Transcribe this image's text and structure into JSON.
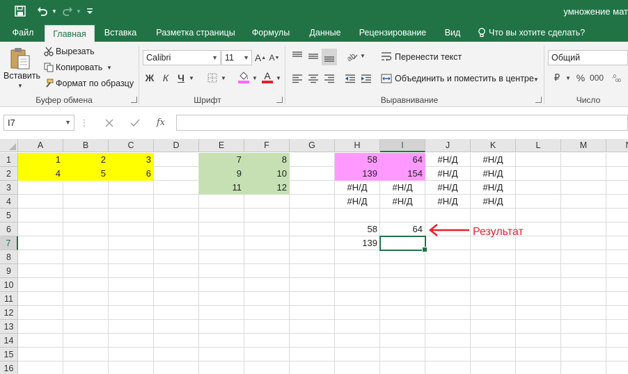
{
  "title_bar": {
    "document_title": "умножение мат",
    "save_icon": "save-icon",
    "undo_icon": "undo-icon",
    "redo_icon": "redo-icon",
    "customize_icon": "customize-qat-icon"
  },
  "tabs": [
    {
      "label": "Файл",
      "active": false
    },
    {
      "label": "Главная",
      "active": true
    },
    {
      "label": "Вставка",
      "active": false
    },
    {
      "label": "Разметка страницы",
      "active": false
    },
    {
      "label": "Формулы",
      "active": false
    },
    {
      "label": "Данные",
      "active": false
    },
    {
      "label": "Рецензирование",
      "active": false
    },
    {
      "label": "Вид",
      "active": false
    }
  ],
  "tell_me": {
    "icon": "lightbulb-icon",
    "label": "Что вы хотите сделать?"
  },
  "ribbon": {
    "clipboard": {
      "paste_label": "Вставить",
      "cut_label": "Вырезать",
      "copy_label": "Копировать",
      "format_painter_label": "Формат по образцу",
      "group_label": "Буфер обмена"
    },
    "font": {
      "font_name": "Calibri",
      "font_size": "11",
      "bold_label": "Ж",
      "italic_label": "К",
      "underline_label": "Ч",
      "group_label": "Шрифт",
      "highlight_color": "#ff66ff",
      "font_color": "#e5202e"
    },
    "alignment": {
      "wrap_text_label": "Перенести текст",
      "merge_center_label": "Объединить и поместить в центре",
      "group_label": "Выравнивание"
    },
    "number": {
      "format": "Общий",
      "currency_symbol": "₽",
      "percent_symbol": "%",
      "thousands_label": "000",
      "group_label": "Число"
    }
  },
  "formula_bar": {
    "name_box": "I7",
    "cancel_icon": "cancel-icon",
    "enter_icon": "check-icon",
    "function_label": "fx",
    "formula": ""
  },
  "sheet": {
    "columns": [
      "A",
      "B",
      "C",
      "D",
      "E",
      "F",
      "G",
      "H",
      "I",
      "J",
      "K",
      "L",
      "M",
      "N"
    ],
    "rows": [
      "1",
      "2",
      "3",
      "4",
      "5",
      "6",
      "7",
      "8",
      "9",
      "10",
      "11",
      "12",
      "13",
      "14",
      "15",
      "16"
    ],
    "selected_column": "I",
    "selected_row": "7",
    "fills": {
      "yellow": "#ffff00",
      "green": "#c6e0b4",
      "pink": "#ff99ff"
    },
    "cells": [
      {
        "ref": "A1",
        "value": "1",
        "fill": "yellow"
      },
      {
        "ref": "B1",
        "value": "2",
        "fill": "yellow"
      },
      {
        "ref": "C1",
        "value": "3",
        "fill": "yellow"
      },
      {
        "ref": "A2",
        "value": "4",
        "fill": "yellow"
      },
      {
        "ref": "B2",
        "value": "5",
        "fill": "yellow"
      },
      {
        "ref": "C2",
        "value": "6",
        "fill": "yellow"
      },
      {
        "ref": "E1",
        "value": "7",
        "fill": "green"
      },
      {
        "ref": "F1",
        "value": "8",
        "fill": "green"
      },
      {
        "ref": "E2",
        "value": "9",
        "fill": "green"
      },
      {
        "ref": "F2",
        "value": "10",
        "fill": "green"
      },
      {
        "ref": "E3",
        "value": "11",
        "fill": "green"
      },
      {
        "ref": "F3",
        "value": "12",
        "fill": "green"
      },
      {
        "ref": "H1",
        "value": "58",
        "fill": "pink"
      },
      {
        "ref": "I1",
        "value": "64",
        "fill": "pink"
      },
      {
        "ref": "H2",
        "value": "139",
        "fill": "pink"
      },
      {
        "ref": "I2",
        "value": "154",
        "fill": "pink"
      },
      {
        "ref": "J1",
        "value": "#Н/Д",
        "align": "center"
      },
      {
        "ref": "K1",
        "value": "#Н/Д",
        "align": "center"
      },
      {
        "ref": "J2",
        "value": "#Н/Д",
        "align": "center"
      },
      {
        "ref": "K2",
        "value": "#Н/Д",
        "align": "center"
      },
      {
        "ref": "H3",
        "value": "#Н/Д",
        "align": "center"
      },
      {
        "ref": "I3",
        "value": "#Н/Д",
        "align": "center"
      },
      {
        "ref": "J3",
        "value": "#Н/Д",
        "align": "center"
      },
      {
        "ref": "K3",
        "value": "#Н/Д",
        "align": "center"
      },
      {
        "ref": "H4",
        "value": "#Н/Д",
        "align": "center"
      },
      {
        "ref": "I4",
        "value": "#Н/Д",
        "align": "center"
      },
      {
        "ref": "J4",
        "value": "#Н/Д",
        "align": "center"
      },
      {
        "ref": "K4",
        "value": "#Н/Д",
        "align": "center"
      },
      {
        "ref": "H6",
        "value": "58"
      },
      {
        "ref": "I6",
        "value": "64"
      },
      {
        "ref": "H7",
        "value": "139"
      }
    ]
  },
  "annotation": {
    "label": "Результат",
    "color": "#e5202e"
  }
}
